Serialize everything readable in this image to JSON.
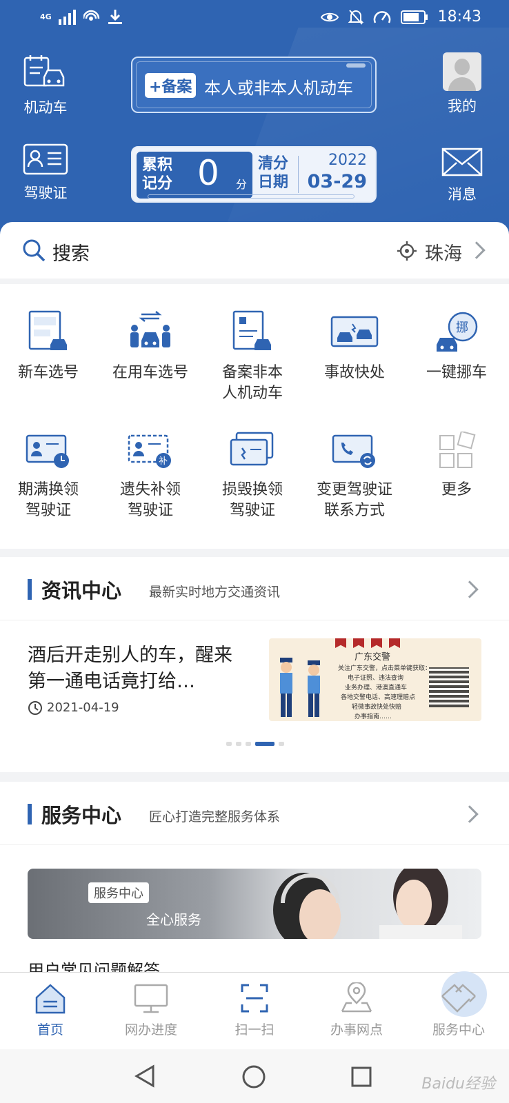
{
  "status_bar": {
    "network": "4G",
    "time": "18:43"
  },
  "header": {
    "vehicle_label": "机动车",
    "license_label": "驾驶证",
    "mine_label": "我的",
    "messages_label": "消息",
    "register_badge": "+备案",
    "register_text": "本人或非本人机动车",
    "points_label": "累积记分",
    "points_value": "0",
    "points_unit": "分",
    "clear_label": "清分日期",
    "clear_year": "2022",
    "clear_date": "03-29"
  },
  "search": {
    "placeholder": "搜索",
    "city": "珠海"
  },
  "services": [
    {
      "label": "新车选号",
      "icon": "new-car-plate-icon"
    },
    {
      "label": "在用车选号",
      "icon": "car-swap-icon"
    },
    {
      "label": "备案非本\n人机动车",
      "icon": "register-document-icon"
    },
    {
      "label": "事故快处",
      "icon": "accident-icon"
    },
    {
      "label": "一键挪车",
      "icon": "move-car-icon"
    },
    {
      "label": "期满换领\n驾驶证",
      "icon": "license-renew-icon"
    },
    {
      "label": "遗失补领\n驾驶证",
      "icon": "license-replace-icon"
    },
    {
      "label": "损毁换领\n驾驶证",
      "icon": "license-damaged-icon"
    },
    {
      "label": "变更驾驶证\n联系方式",
      "icon": "contact-change-icon"
    },
    {
      "label": "更多",
      "icon": "more-grid-icon"
    }
  ],
  "news": {
    "title": "资讯中心",
    "subtitle": "最新实时地方交通资讯",
    "item_title": "酒后开走别人的车，醒来第一通电话竟打给…",
    "item_date": "2021-04-19",
    "image_heading": "广东交警",
    "image_lines": [
      "关注广东交警，点击菜单键获取：",
      "电子证照、违法查询",
      "业务办理、港澳直通车",
      "各地交警电话、高速理赔点",
      "轻微事故快处快赔",
      "办事指南……"
    ]
  },
  "service_center": {
    "title": "服务中心",
    "subtitle": "匠心打造完整服务体系",
    "banner_tag": "服务中心",
    "banner_text": "全心服务",
    "faq": "用户常见问题解答"
  },
  "bottom_nav": [
    {
      "label": "首页",
      "icon": "home-icon",
      "active": true
    },
    {
      "label": "网办进度",
      "icon": "monitor-icon",
      "active": false
    },
    {
      "label": "扫一扫",
      "icon": "scan-icon",
      "active": false
    },
    {
      "label": "办事网点",
      "icon": "map-pin-icon",
      "active": false
    },
    {
      "label": "服务中心",
      "icon": "handshake-icon",
      "active": false
    }
  ],
  "watermark": "Baidu经验",
  "colors": {
    "primary": "#2f64b2",
    "background": "#f2f3f5"
  }
}
